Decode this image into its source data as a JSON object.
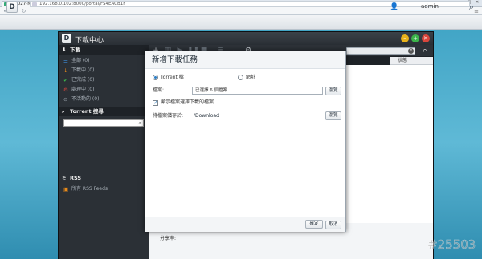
{
  "browser": {
    "tab_title": "RS1027-NASA",
    "url": "192.168.0.102:8000/portal/FS4EACB1F",
    "tab_close": "×",
    "menu_icon": "menu-icon"
  },
  "dsm": {
    "logo_letter": "D",
    "username": "admin"
  },
  "app": {
    "title": "下載中心",
    "logo_letter": "D",
    "sidebar": {
      "downloads_header": "下載",
      "items": [
        {
          "label": "全部 (0)",
          "icon": "list-icon",
          "color": "#3d8bd8"
        },
        {
          "label": "下載中 (0)",
          "icon": "arrow-down-icon",
          "color": "#e88a1a"
        },
        {
          "label": "已完成 (0)",
          "icon": "check-circle-icon",
          "color": "#3bb34a"
        },
        {
          "label": "處理中 (0)",
          "icon": "gear-circle-icon",
          "color": "#d9463c"
        },
        {
          "label": "不活動的 (0)",
          "icon": "minus-circle-icon",
          "color": "#9aa3ac"
        }
      ],
      "torrent_search_header": "Torrent 搜尋",
      "rss_header": "RSS",
      "rss_item": "所有 RSS Feeds"
    },
    "column_header": "狀態",
    "share_label": "分享率:",
    "share_value": "--"
  },
  "modal": {
    "title": "新增下載任務",
    "radio_torrent": "Torrent 檔",
    "radio_url": "網址",
    "file_label": "檔案:",
    "file_value": "已選擇 6 個檔案",
    "browse_label": "瀏覽",
    "checkbox_label": "顯示檔案選擇下載的檔案",
    "dest_label": "將檔案儲存於:",
    "dest_value": "/Download",
    "browse2_label": "瀏覽",
    "ok_label": "確定",
    "cancel_label": "取消"
  },
  "watermark": "#25503",
  "colors": {
    "desktop": "#4aaccb",
    "app_dark": "#1e2227",
    "close_red": "#d9463c",
    "max_green": "#3bb34a",
    "min_yellow": "#e8b21a"
  }
}
